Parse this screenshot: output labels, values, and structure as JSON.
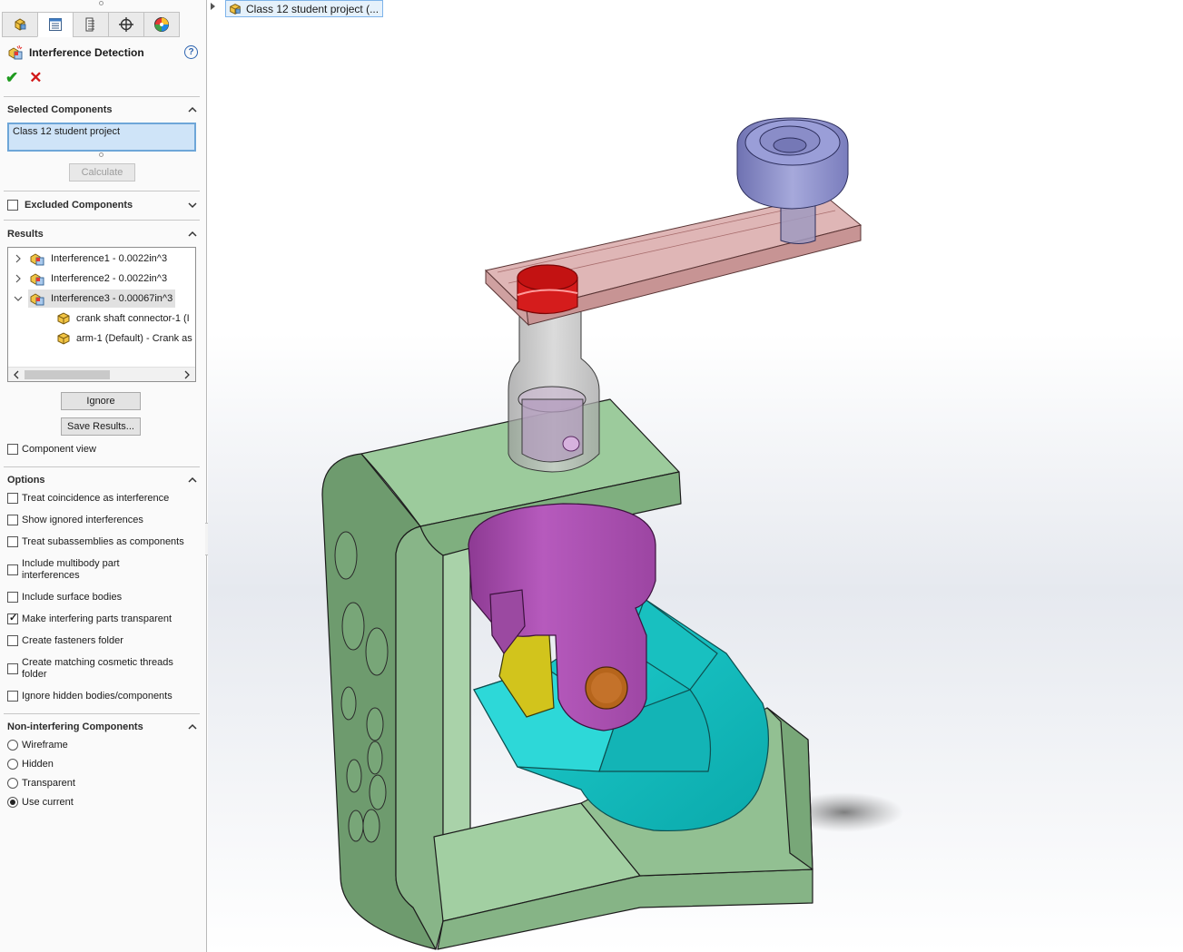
{
  "window": {
    "breadcrumb": "Class 12 student project (..."
  },
  "panel_tabs": [
    {
      "name": "feature-manager-tab",
      "icon": "assembly-icon"
    },
    {
      "name": "property-manager-tab",
      "icon": "property-manager-icon"
    },
    {
      "name": "configuration-manager-tab",
      "icon": "configuration-icon"
    },
    {
      "name": "dimxpert-tab",
      "icon": "crosshair-icon"
    },
    {
      "name": "display-manager-tab",
      "icon": "appearance-icon"
    }
  ],
  "property_manager": {
    "title": "Interference Detection",
    "help": "?",
    "ok": "✔",
    "cancel": "✕"
  },
  "selected_components": {
    "header": "Selected Components",
    "value": "Class 12 student project",
    "calculate_label": "Calculate"
  },
  "excluded_components": {
    "header": "Excluded Components",
    "checked": false
  },
  "results": {
    "header": "Results",
    "items": [
      {
        "label": "Interference1 - 0.0022in^3",
        "expanded": false
      },
      {
        "label": "Interference2 - 0.0022in^3",
        "expanded": false
      },
      {
        "label": "Interference3 - 0.00067in^3",
        "expanded": true,
        "selected": true
      }
    ],
    "children": [
      {
        "label": "crank shaft connector-1 (I"
      },
      {
        "label": "arm-1 (Default) - Crank as"
      }
    ],
    "ignore_label": "Ignore",
    "save_label": "Save Results...",
    "component_view_label": "Component view"
  },
  "options": {
    "header": "Options",
    "items": [
      {
        "label": "Treat coincidence as interference",
        "checked": false
      },
      {
        "label": "Show ignored interferences",
        "checked": false
      },
      {
        "label": "Treat subassemblies as components",
        "checked": false
      },
      {
        "label": "Include multibody part interferences",
        "checked": false
      },
      {
        "label": "Include surface bodies",
        "checked": false
      },
      {
        "label": "Make interfering parts transparent",
        "checked": true
      },
      {
        "label": "Create fasteners folder",
        "checked": false
      },
      {
        "label": "Create matching cosmetic threads folder",
        "checked": false
      },
      {
        "label": "Ignore hidden bodies/components",
        "checked": false
      }
    ]
  },
  "non_interfering": {
    "header": "Non-interfering Components",
    "items": [
      {
        "label": "Wireframe",
        "checked": false
      },
      {
        "label": "Hidden",
        "checked": false
      },
      {
        "label": "Transparent",
        "checked": false
      },
      {
        "label": "Use current",
        "checked": true
      }
    ]
  },
  "colors": {
    "frame_green": "#8fc08f",
    "arm_pink": "#d8a6a6",
    "knob_blue": "#8c8fc6",
    "yoke_magenta": "#a94fae",
    "block_cyan": "#1fc3c3",
    "interference_red": "#d51c1c",
    "selection_blue": "#cfe4f8"
  }
}
